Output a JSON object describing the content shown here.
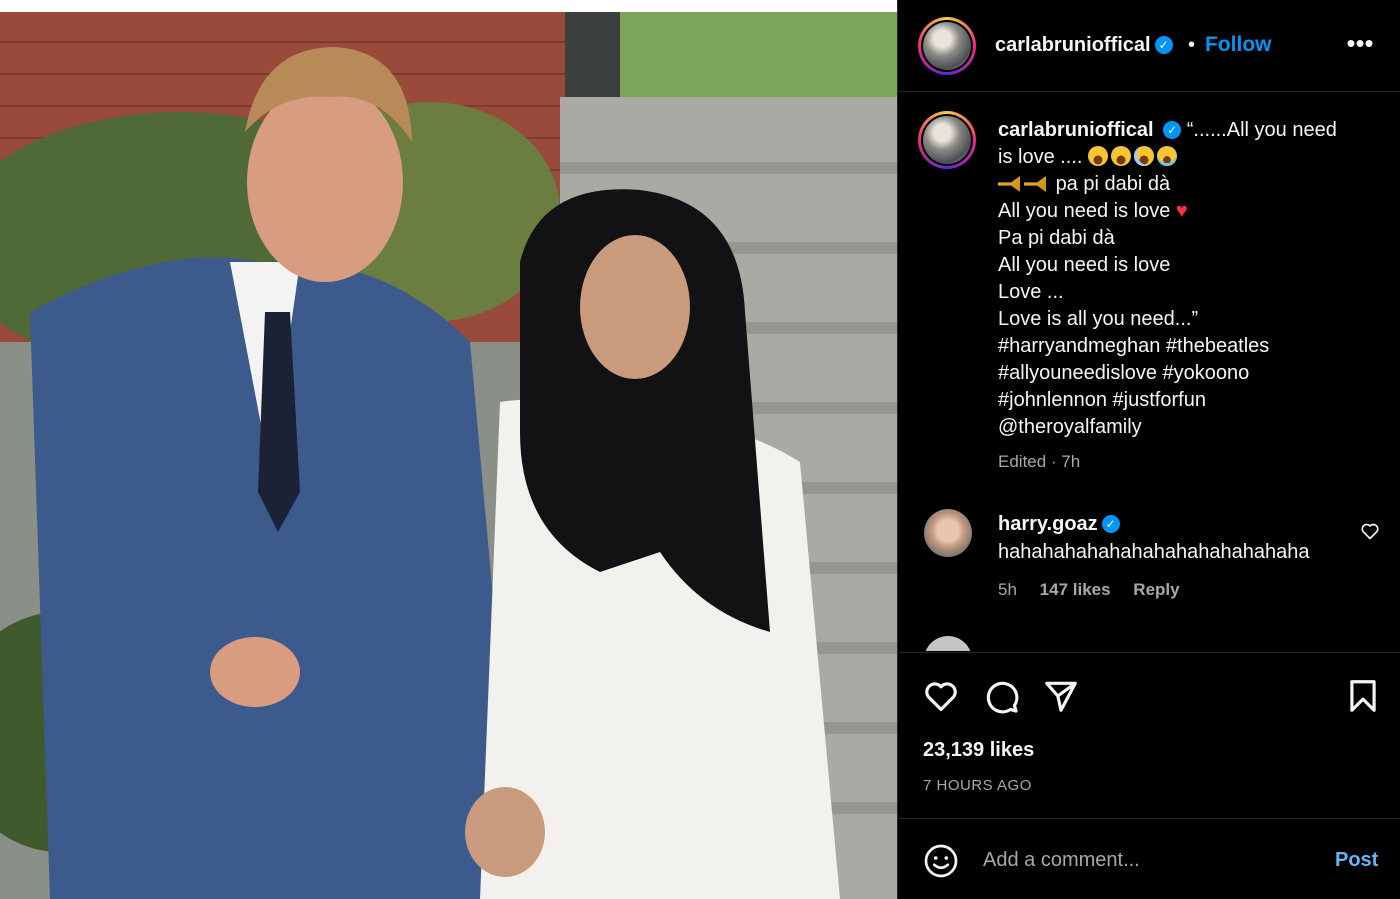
{
  "header": {
    "username": "carlabrunioffical",
    "verified_icon": "verified-badge-icon",
    "dot": "•",
    "follow_label": "Follow",
    "more_icon": "more-options-icon",
    "more_glyph": "•••"
  },
  "caption": {
    "username": "carlabrunioffical",
    "line1": "“......All you need",
    "line2": "is love ....",
    "line3": "pa pi dabi dà",
    "line4": "All you need is love",
    "line5": "Pa pi dabi dà",
    "line6": "All you need is love",
    "line7": "Love ...",
    "line8": "Love is all you need...”",
    "line9": "#harryandmeghan #thebeatles",
    "line10": "#allyouneedislove #yokoono",
    "line11": "#johnlennon #justforfun",
    "line12": "@theroyalfamily",
    "edited": "Edited · 7h"
  },
  "comment": {
    "username": "harry.goaz",
    "text": "hahahahahahahahahahahahahaha",
    "time": "5h",
    "likes": "147 likes",
    "reply_label": "Reply"
  },
  "actions": {
    "icons": [
      "heart-icon",
      "comment-icon",
      "share-icon",
      "bookmark-icon"
    ],
    "likes_count": "23,139 likes",
    "time_ago": "7 HOURS AGO"
  },
  "add_comment": {
    "placeholder": "Add a comment...",
    "post_label": "Post"
  },
  "colors": {
    "background": "#000000",
    "accent_blue": "#0095f6",
    "muted_text": "#a8a8a8",
    "heart_red": "#ff3040"
  }
}
